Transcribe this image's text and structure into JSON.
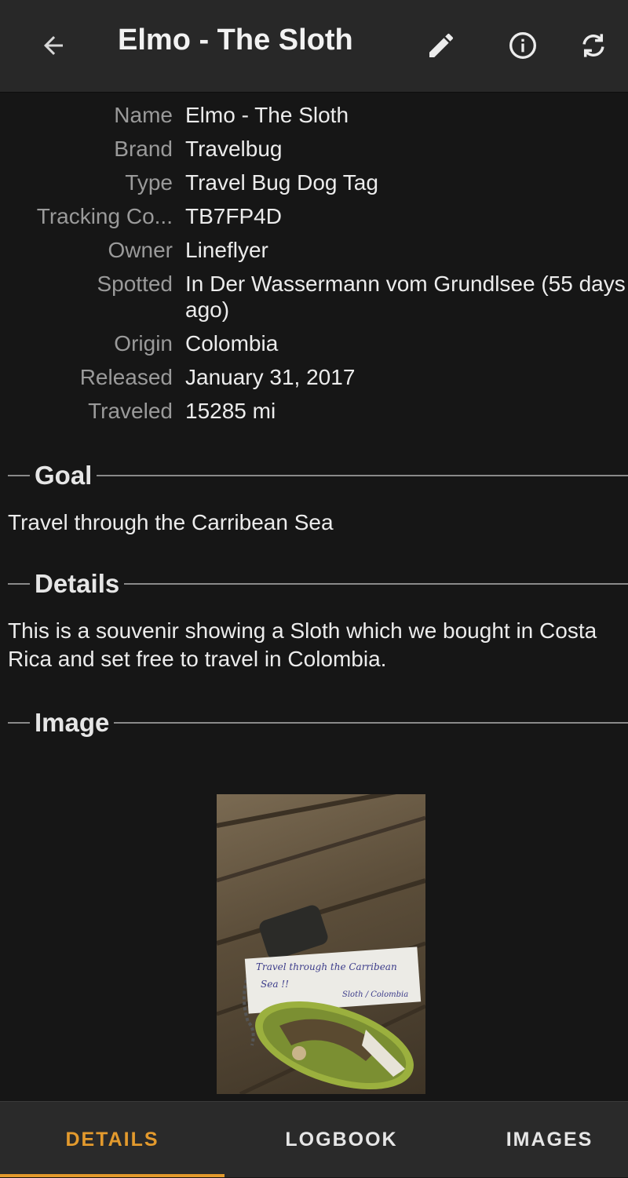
{
  "header": {
    "title": "Elmo - The Sloth",
    "back_icon": "arrow-left-icon",
    "edit_icon": "pencil-icon",
    "info_icon": "info-circle-icon",
    "refresh_icon": "sync-icon"
  },
  "details": [
    {
      "label": "Name",
      "value": "Elmo - The Sloth"
    },
    {
      "label": "Brand",
      "value": "Travelbug"
    },
    {
      "label": "Type",
      "value": "Travel Bug Dog Tag"
    },
    {
      "label": "Tracking Co...",
      "value": "TB7FP4D"
    },
    {
      "label": "Owner",
      "value": "Lineflyer"
    },
    {
      "label": "Spotted",
      "value": "In Der Wassermann vom Grundlsee (55 days ago)"
    },
    {
      "label": "Origin",
      "value": "Colombia"
    },
    {
      "label": "Released",
      "value": "January 31, 2017"
    },
    {
      "label": "Traveled",
      "value": "15285 mi"
    }
  ],
  "goal": {
    "title": "Goal",
    "text": "Travel through the Carribean Sea"
  },
  "description": {
    "title": "Details",
    "text": "This is a souvenir showing a Sloth which we bought in Costa Rica and set free to travel in Colombia."
  },
  "image_section": {
    "title": "Image",
    "note_line1": "Travel through the Carribean",
    "note_line2": "Sea !!",
    "note_sign": "Sloth / Colombia"
  },
  "tabs": [
    {
      "label": "DETAILS",
      "active": true
    },
    {
      "label": "LOGBOOK",
      "active": false
    },
    {
      "label": "IMAGES",
      "active": false
    }
  ],
  "colors": {
    "accent": "#e39a2d",
    "background": "#161616",
    "appbar": "#282828"
  }
}
